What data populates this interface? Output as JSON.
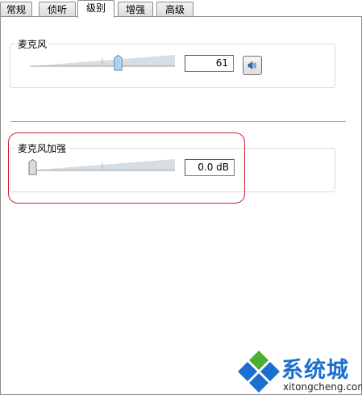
{
  "tabs": [
    {
      "label": "常规"
    },
    {
      "label": "侦听"
    },
    {
      "label": "级别"
    },
    {
      "label": "增强"
    },
    {
      "label": "高级"
    }
  ],
  "active_tab": "级别",
  "microphone": {
    "title": "麦克风",
    "level_percent": 61,
    "value": "61",
    "speaker_icon": "speaker-icon"
  },
  "boost": {
    "title": "麦克风加强",
    "level_percent": 0,
    "value": "0.0 dB"
  },
  "watermark": {
    "text": "系统城",
    "url_text": "xitongcheng.com"
  },
  "colors": {
    "highlight": "#c8252b",
    "logo_blue": "#1b6fd0",
    "logo_green": "#4cae2e"
  }
}
